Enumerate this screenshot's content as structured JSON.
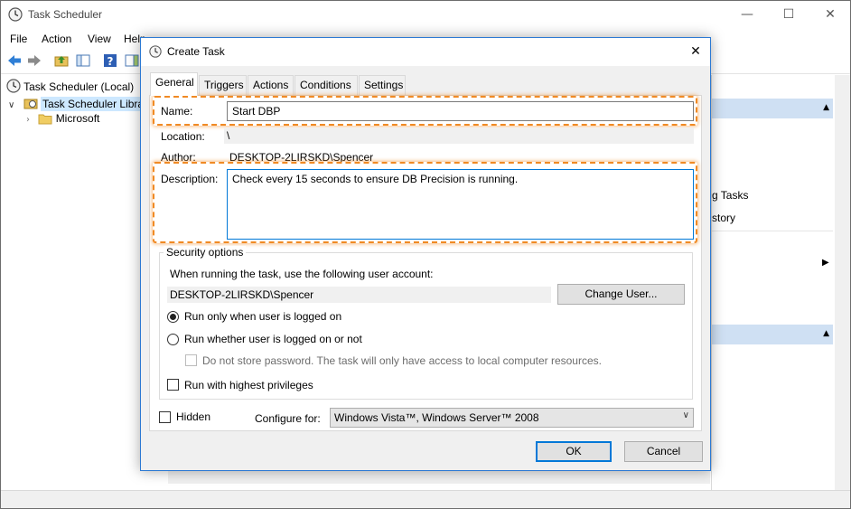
{
  "main_window": {
    "title": "Task Scheduler",
    "menu": [
      "File",
      "Action",
      "View",
      "Help"
    ],
    "tree": {
      "root": "Task Scheduler (Local)",
      "library": "Task Scheduler Library",
      "child": "Microsoft"
    },
    "actions_partial": [
      "g Tasks",
      "story"
    ]
  },
  "dialog": {
    "title": "Create Task",
    "tabs": [
      "General",
      "Triggers",
      "Actions",
      "Conditions",
      "Settings"
    ],
    "general": {
      "name_label": "Name:",
      "name_value": "Start DBP",
      "location_label": "Location:",
      "location_value": "\\",
      "author_label": "Author:",
      "author_value": "DESKTOP-2LIRSKD\\Spencer",
      "description_label": "Description:",
      "description_value": "Check every 15 seconds to ensure DB Precision is running.",
      "security": {
        "legend": "Security options",
        "account_prompt": "When running the task, use the following user account:",
        "account_value": "DESKTOP-2LIRSKD\\Spencer",
        "change_user_label": "Change User...",
        "radio_logged_on": "Run only when user is logged on",
        "radio_whether": "Run whether user is logged on or not",
        "radio_selected": "logged_on",
        "no_store_password": "Do not store password.  The task will only have access to local computer resources.",
        "highest_privileges": "Run with highest privileges"
      },
      "hidden_label": "Hidden",
      "configure_label": "Configure for:",
      "configure_value": "Windows Vista™, Windows Server™ 2008"
    },
    "ok_label": "OK",
    "cancel_label": "Cancel"
  },
  "colors": {
    "highlight": "#f08a24",
    "focus_border": "#0078d7",
    "window_border": "#2b79d3"
  }
}
